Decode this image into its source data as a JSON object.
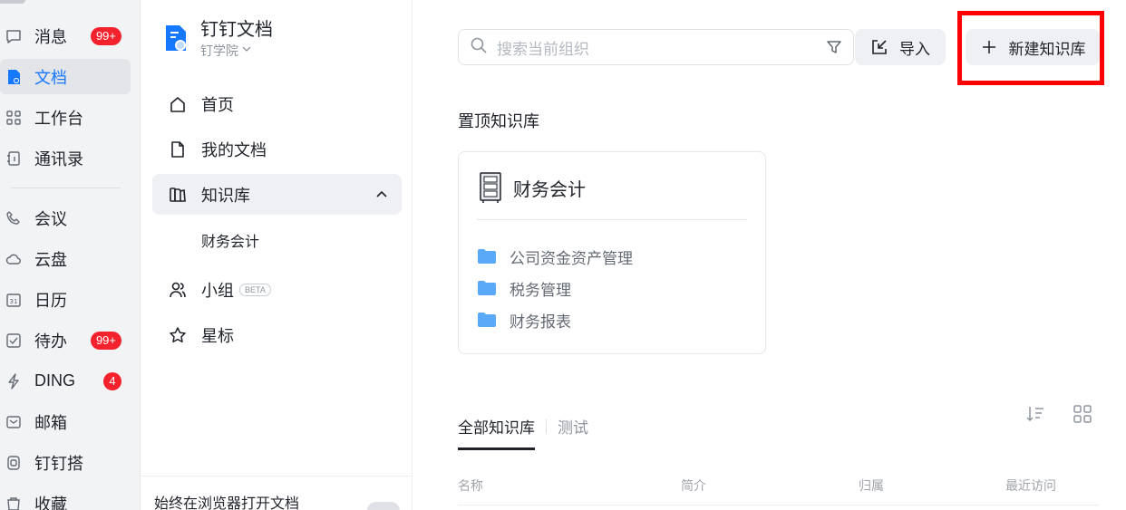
{
  "app_nav": {
    "items": [
      {
        "label": "消息",
        "badge": "99+"
      },
      {
        "label": "文档",
        "active": true
      },
      {
        "label": "工作台"
      },
      {
        "label": "通讯录"
      },
      {
        "label": "会议"
      },
      {
        "label": "云盘"
      },
      {
        "label": "日历"
      },
      {
        "label": "待办",
        "badge": "99+"
      },
      {
        "label": "DING",
        "badge": "4"
      },
      {
        "label": "邮箱"
      },
      {
        "label": "钉钉搭"
      },
      {
        "label": "收藏"
      }
    ]
  },
  "doc_sidebar": {
    "app_title": "钉钉文档",
    "workspace": "钉学院",
    "items": [
      {
        "label": "首页"
      },
      {
        "label": "我的文档"
      },
      {
        "label": "知识库",
        "expanded": true
      },
      {
        "label": "小组",
        "tag": "BETA"
      },
      {
        "label": "星标"
      }
    ],
    "sub_items": [
      "财务会计"
    ],
    "footer_text": "始终在浏览器打开文档"
  },
  "main": {
    "search_placeholder": "搜索当前组织",
    "import_label": "导入",
    "new_kb_label": "新建知识库",
    "pinned_title": "置顶知识库",
    "pinned_card": {
      "name": "财务会计",
      "folders": [
        "公司资金资产管理",
        "税务管理",
        "财务报表"
      ]
    },
    "tabs": [
      "全部知识库",
      "测试"
    ],
    "columns": [
      "名称",
      "简介",
      "归属",
      "最近访问"
    ]
  },
  "colors": {
    "accent": "#1677ff",
    "badge": "#f5222d",
    "highlight": "#ff0000",
    "folder": "#5aa9f9"
  }
}
